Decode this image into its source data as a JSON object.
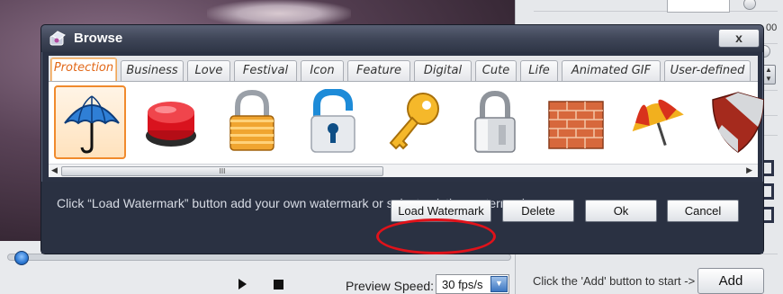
{
  "app": {
    "preview": {
      "label": "Preview Speed:",
      "fps_value": "30 fps/s"
    },
    "hint": "Click the 'Add' button to start ->",
    "add_label": "Add",
    "zoom_label": "00"
  },
  "dialog": {
    "title": "Browse",
    "close_label": "x",
    "tabs": [
      {
        "label": "Protection",
        "active": true
      },
      {
        "label": "Business"
      },
      {
        "label": "Love"
      },
      {
        "label": "Festival"
      },
      {
        "label": "Icon"
      },
      {
        "label": "Feature"
      },
      {
        "label": "Digital"
      },
      {
        "label": "Cute"
      },
      {
        "label": "Life"
      },
      {
        "label": "Animated GIF"
      },
      {
        "label": "User-defined"
      }
    ],
    "icons": [
      {
        "name": "umbrella-icon",
        "selected": true
      },
      {
        "name": "red-button-icon"
      },
      {
        "name": "golden-padlock-icon"
      },
      {
        "name": "blue-lock-icon"
      },
      {
        "name": "key-icon"
      },
      {
        "name": "silver-padlock-icon"
      },
      {
        "name": "brick-wall-icon"
      },
      {
        "name": "striped-umbrella-icon"
      },
      {
        "name": "shield-icon"
      }
    ],
    "scroll_grip": "III",
    "info_text": "Click “Load Watermark” button add your own watermark or select existing watermark.",
    "buttons": {
      "load": "Load Watermark",
      "delete": "Delete",
      "ok": "Ok",
      "cancel": "Cancel"
    }
  },
  "colors": {
    "dialog_bg": "#2b3244",
    "active_tab": "#e2691a",
    "annotation": "#e0121a"
  }
}
